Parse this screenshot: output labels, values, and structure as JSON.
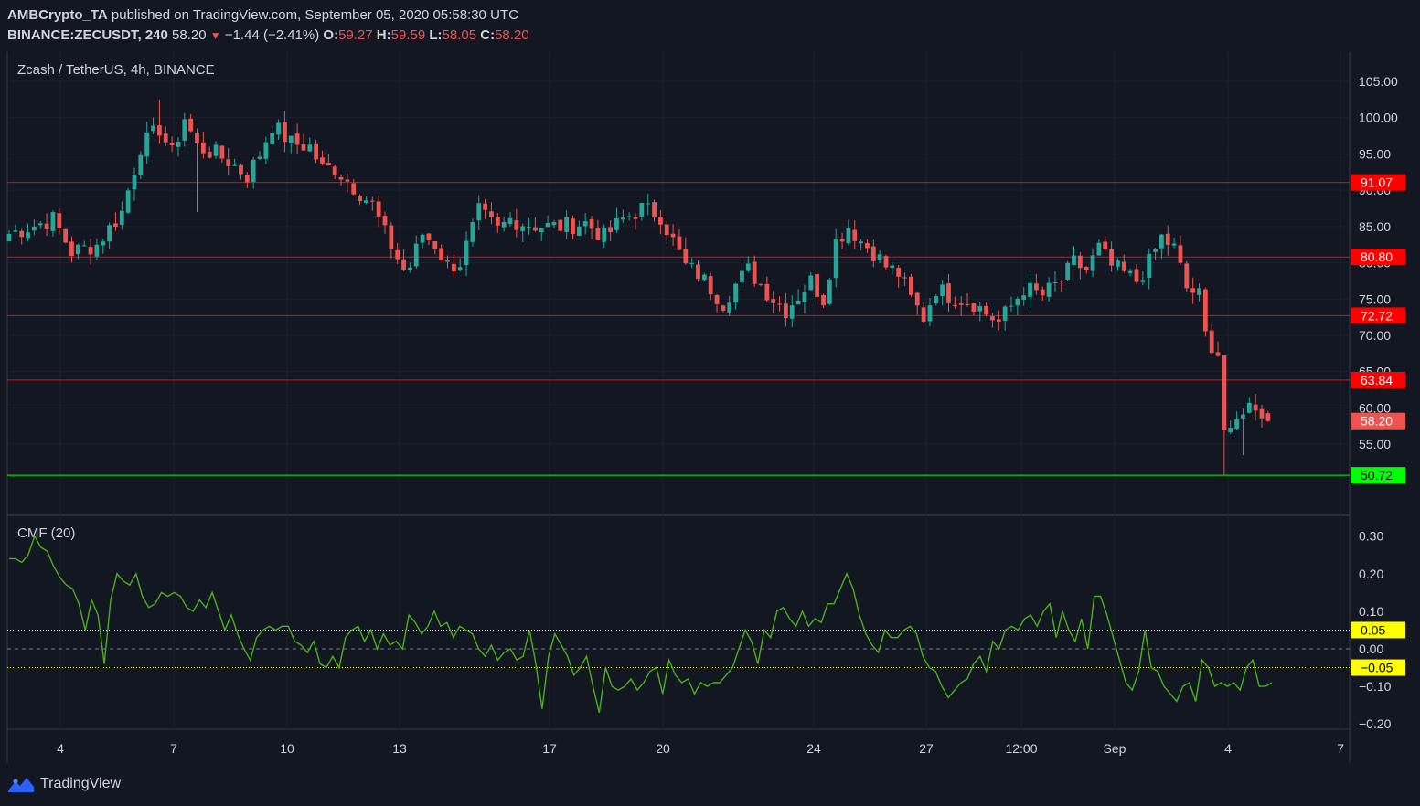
{
  "header": {
    "publisher": "AMBCrypto_TA",
    "published_text": "published on TradingView.com, September 05, 2020 05:58:30 UTC",
    "symbol": "BINANCE:ZECUSDT, 240",
    "last": "58.20",
    "change": "−1.44 (−2.41%)",
    "o_label": "O:",
    "o": "59.27",
    "h_label": "H:",
    "h": "59.59",
    "l_label": "L:",
    "l": "58.05",
    "c_label": "C:",
    "c": "58.20"
  },
  "footer": {
    "brand": "TradingView",
    "logo_icon": "tradingview-logo-icon"
  },
  "colors": {
    "background": "#131722",
    "up": "#26a69a",
    "down": "#ef5350",
    "resistance": "#ff0000",
    "support": "#00ff00",
    "cmf": "#4caf1a",
    "cmf_band": "#ffff00"
  },
  "chart_data": [
    {
      "type": "candlestick",
      "title": "Zcash / TetherUS, 4h, BINANCE",
      "y_ticks": [
        "55.00",
        "60.00",
        "65.00",
        "70.00",
        "75.00",
        "80.00",
        "85.00",
        "90.00",
        "95.00",
        "100.00",
        "105.00"
      ],
      "ylim": [
        45.5,
        107
      ],
      "x_ticks": [
        "4",
        "7",
        "10",
        "13",
        "17",
        "20",
        "24",
        "27",
        "12:00",
        "Sep",
        "4",
        "7"
      ],
      "horizontal_levels": [
        {
          "value": 91.07,
          "label": "91.07",
          "color": "#ff0000"
        },
        {
          "value": 80.8,
          "label": "80.80",
          "color": "#ff0000"
        },
        {
          "value": 72.72,
          "label": "72.72",
          "color": "#ff0000"
        },
        {
          "value": 63.84,
          "label": "63.84",
          "color": "#ff0000"
        },
        {
          "value": 50.72,
          "label": "50.72",
          "color": "#00ff00"
        }
      ],
      "last_price": {
        "value": 58.2,
        "label": "58.20"
      },
      "close_path": [
        [
          0,
          84
        ],
        [
          7,
          86
        ],
        [
          10,
          81.5
        ],
        [
          14,
          82.5
        ],
        [
          18,
          87
        ],
        [
          21,
          96
        ],
        [
          24,
          98.5
        ],
        [
          26,
          95
        ],
        [
          28,
          100
        ],
        [
          30,
          96
        ],
        [
          33,
          95
        ],
        [
          35,
          94
        ],
        [
          38,
          92
        ],
        [
          40,
          95
        ],
        [
          42,
          99
        ],
        [
          45,
          96.5
        ],
        [
          48,
          96
        ],
        [
          50,
          93
        ],
        [
          52,
          93
        ],
        [
          55,
          90.5
        ],
        [
          58,
          88
        ],
        [
          60,
          84
        ],
        [
          63,
          79
        ],
        [
          64,
          79.5
        ],
        [
          66,
          84
        ],
        [
          68,
          82.5
        ],
        [
          70,
          79.5
        ],
        [
          72,
          80
        ],
        [
          75,
          87
        ],
        [
          78,
          84.5
        ],
        [
          80,
          86
        ],
        [
          82,
          85.5
        ],
        [
          85,
          85
        ],
        [
          88,
          85
        ],
        [
          92,
          85.5
        ],
        [
          95,
          83.5
        ],
        [
          98,
          86
        ],
        [
          101,
          87.5
        ],
        [
          104,
          86.5
        ],
        [
          106,
          83
        ],
        [
          108,
          79.5
        ],
        [
          110,
          78.5
        ],
        [
          112,
          76.5
        ],
        [
          114,
          74.5
        ],
        [
          116,
          77
        ],
        [
          118,
          79
        ],
        [
          120,
          77
        ],
        [
          122,
          75
        ],
        [
          124,
          73.5
        ],
        [
          126,
          75.5
        ],
        [
          128,
          77.5
        ],
        [
          130,
          75
        ],
        [
          132,
          83
        ],
        [
          134,
          85
        ],
        [
          136,
          83
        ],
        [
          138,
          81.5
        ],
        [
          140,
          79.5
        ],
        [
          142,
          78.5
        ],
        [
          144,
          75
        ],
        [
          146,
          72.5
        ],
        [
          148,
          76.5
        ],
        [
          150,
          75.5
        ],
        [
          152,
          75
        ],
        [
          154,
          74.5
        ],
        [
          156,
          73
        ],
        [
          158,
          71.8
        ],
        [
          160,
          74
        ],
        [
          162,
          76.5
        ],
        [
          165,
          75.5
        ],
        [
          168,
          77.5
        ],
        [
          170,
          80
        ],
        [
          172,
          79
        ],
        [
          174,
          82
        ],
        [
          176,
          79.5
        ],
        [
          178,
          78.5
        ],
        [
          180,
          77.5
        ],
        [
          182,
          80
        ],
        [
          184,
          83.5
        ],
        [
          186,
          82
        ],
        [
          188,
          76.5
        ],
        [
          190,
          75.5
        ],
        [
          191,
          70
        ],
        [
          193,
          67.5
        ],
        [
          194,
          57
        ],
        [
          195,
          56
        ],
        [
          197,
          60
        ],
        [
          199,
          60.5
        ],
        [
          201,
          58.2
        ]
      ]
    },
    {
      "type": "line",
      "title": "CMF (20)",
      "y_ticks": [
        "−0.20",
        "−0.10",
        "0.00",
        "0.10",
        "0.20",
        "0.30"
      ],
      "ylim": [
        -0.22,
        0.33
      ],
      "bands": [
        {
          "value": 0.05,
          "label": "0.05",
          "color": "#ffff00"
        },
        {
          "value": -0.05,
          "label": "−0.05",
          "color": "#ffff00"
        }
      ],
      "zero_line": 0,
      "series": [
        {
          "values": [
            0.24,
            0.24,
            0.23,
            0.25,
            0.3,
            0.27,
            0.26,
            0.22,
            0.19,
            0.17,
            0.16,
            0.12,
            0.05,
            0.13,
            0.09,
            -0.04,
            0.13,
            0.2,
            0.18,
            0.17,
            0.2,
            0.14,
            0.11,
            0.12,
            0.15,
            0.14,
            0.15,
            0.14,
            0.11,
            0.1,
            0.13,
            0.11,
            0.15,
            0.1,
            0.05,
            0.09,
            0.04,
            0.0,
            -0.03,
            0.03,
            0.05,
            0.06,
            0.05,
            0.06,
            0.06,
            0.02,
            0.01,
            -0.01,
            0.02,
            -0.04,
            -0.05,
            -0.02,
            -0.05,
            0.03,
            0.05,
            0.06,
            0.02,
            0.05,
            0.0,
            0.04,
            0.01,
            0.02,
            0.0,
            0.09,
            0.07,
            0.04,
            0.06,
            0.1,
            0.06,
            0.07,
            0.03,
            0.06,
            0.05,
            0.04,
            0.0,
            -0.02,
            0.01,
            -0.03,
            -0.01,
            0.0,
            -0.03,
            -0.02,
            0.05,
            -0.04,
            -0.16,
            -0.02,
            0.04,
            0.01,
            -0.02,
            -0.07,
            -0.05,
            -0.02,
            -0.1,
            -0.17,
            -0.05,
            -0.1,
            -0.11,
            -0.1,
            -0.08,
            -0.11,
            -0.09,
            -0.06,
            -0.05,
            -0.12,
            -0.03,
            -0.07,
            -0.09,
            -0.08,
            -0.12,
            -0.09,
            -0.1,
            -0.09,
            -0.09,
            -0.07,
            -0.05,
            0.0,
            0.05,
            0.02,
            -0.04,
            0.05,
            0.03,
            0.1,
            0.11,
            0.08,
            0.06,
            0.1,
            0.06,
            0.08,
            0.07,
            0.12,
            0.12,
            0.16,
            0.2,
            0.16,
            0.09,
            0.04,
            0.01,
            -0.01,
            0.05,
            0.03,
            0.03,
            0.05,
            0.06,
            0.04,
            -0.02,
            -0.05,
            -0.06,
            -0.1,
            -0.13,
            -0.11,
            -0.09,
            -0.08,
            -0.04,
            -0.02,
            -0.06,
            0.02,
            0.0,
            0.05,
            0.06,
            0.05,
            0.08,
            0.09,
            0.06,
            0.1,
            0.12,
            0.03,
            0.1,
            0.05,
            0.02,
            0.08,
            0.0,
            0.14,
            0.14,
            0.09,
            0.03,
            -0.03,
            -0.09,
            -0.11,
            -0.06,
            0.05,
            -0.05,
            -0.06,
            -0.1,
            -0.12,
            -0.14,
            -0.1,
            -0.09,
            -0.14,
            -0.03,
            -0.05,
            -0.1,
            -0.09,
            -0.1,
            -0.09,
            -0.11,
            -0.05,
            -0.03,
            -0.1,
            -0.1,
            -0.09
          ]
        }
      ]
    }
  ]
}
